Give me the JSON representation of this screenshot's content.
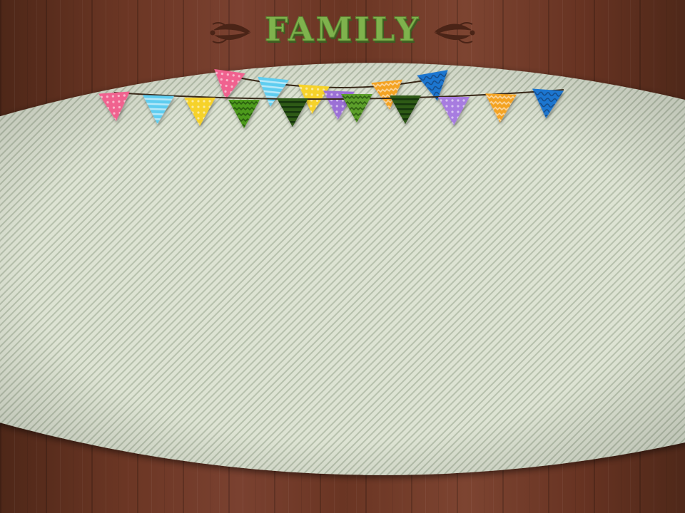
{
  "title": "FAMILY",
  "colors": {
    "wood_dark": "#4e2718",
    "wood_mid": "#7a3f2a",
    "wood_light": "#8e5037",
    "panel": "#dde3d3",
    "panel_stripe": "#b7c1ad",
    "title_fill": "#7fb24d",
    "title_shadow": "#3e5d22",
    "flourish": "#4a2417",
    "string": "#3a2a1a"
  },
  "bunting": {
    "back_row": [
      {
        "color": "#f0628f",
        "pattern": "dots"
      },
      {
        "color": "#5ecdf0",
        "pattern": "stripes"
      },
      {
        "color": "#f6d22a",
        "pattern": "dots"
      },
      {
        "color": "#9b6fd6",
        "pattern": "dots"
      },
      {
        "color": "#f4a321",
        "pattern": "zigzag"
      },
      {
        "color": "#1f76d0",
        "pattern": "waves"
      }
    ],
    "front_row": [
      {
        "color": "#f0628f",
        "pattern": "dots"
      },
      {
        "color": "#5ecdf0",
        "pattern": "stripes"
      },
      {
        "color": "#f6d22a",
        "pattern": "dots"
      },
      {
        "color": "#4d9a1f",
        "pattern": "zigzag"
      },
      {
        "color": "#2e5a16",
        "pattern": "stripes"
      },
      {
        "color": "#5b9f2a",
        "pattern": "zigzag"
      },
      {
        "color": "#2e5a16",
        "pattern": "stripes"
      },
      {
        "color": "#a77ce0",
        "pattern": "dots"
      },
      {
        "color": "#f4a321",
        "pattern": "zigzag"
      },
      {
        "color": "#1f76d0",
        "pattern": "waves"
      }
    ]
  }
}
